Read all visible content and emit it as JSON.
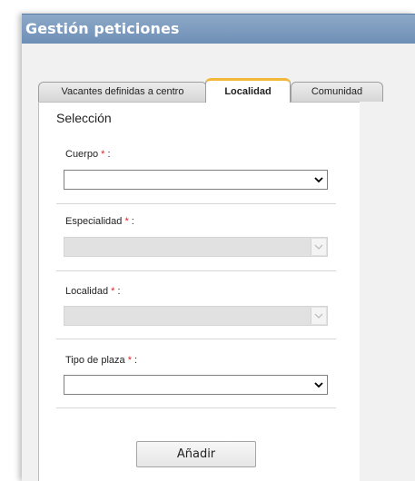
{
  "window": {
    "title": "Gestión peticiones"
  },
  "tabs": [
    {
      "label": "Vacantes definidas a centro",
      "active": false
    },
    {
      "label": "Localidad",
      "active": true
    },
    {
      "label": "Comunidad",
      "active": false
    }
  ],
  "panel": {
    "section_title": "Selección",
    "fields": [
      {
        "label": "Cuerpo",
        "required_mark": "*",
        "colon": ":",
        "value": "",
        "enabled": true
      },
      {
        "label": "Especialidad",
        "required_mark": "*",
        "colon": ":",
        "value": "",
        "enabled": false
      },
      {
        "label": "Localidad",
        "required_mark": "*",
        "colon": ":",
        "value": "",
        "enabled": false
      },
      {
        "label": "Tipo de plaza",
        "required_mark": "*",
        "colon": ":",
        "value": "",
        "enabled": true
      }
    ],
    "add_button": "Añadir"
  },
  "colors": {
    "titlebar": "#7b9abf",
    "active_tab_accent": "#f3b83a",
    "required_mark": "#e02020",
    "disabled_field": "#e1e1e1"
  },
  "icons": {
    "select_arrow": "chevron-down-icon"
  }
}
